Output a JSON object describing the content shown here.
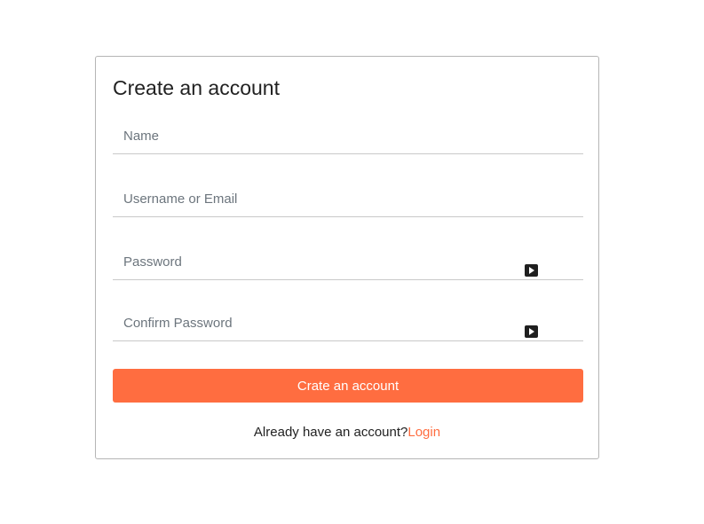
{
  "form": {
    "title": "Create an account",
    "fields": {
      "name": {
        "placeholder": "Name",
        "value": ""
      },
      "username_email": {
        "placeholder": "Username or Email",
        "value": ""
      },
      "password": {
        "placeholder": "Password",
        "value": ""
      },
      "confirm_password": {
        "placeholder": "Confirm Password",
        "value": ""
      }
    },
    "password_toggle_icon": "play-icon",
    "submit_label": "Crate an account",
    "footer": {
      "prompt": "Already have an account?",
      "login_link": "Login"
    }
  },
  "colors": {
    "accent": "#ff6d40",
    "border": "#b5b5b5",
    "text": "#222222",
    "placeholder": "#6c757d",
    "toggle_icon_bg": "#1f1f1f"
  }
}
